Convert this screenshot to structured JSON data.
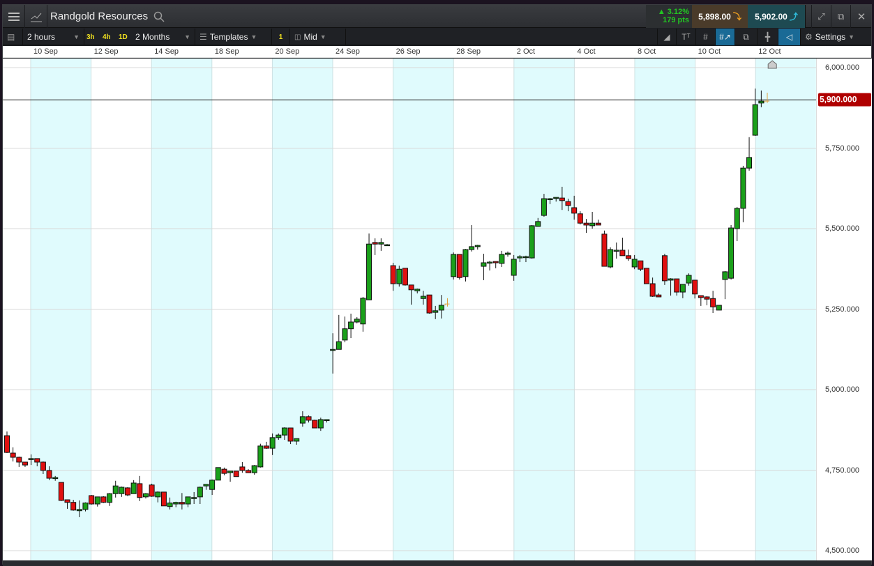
{
  "header": {
    "instrument": "Randgold Resources",
    "change_pct": "▲ 3.12%",
    "change_pts": "179 pts",
    "sell_price": "5,898.00",
    "buy_price": "5,902.00"
  },
  "toolbar": {
    "interval": "2 hours",
    "quick": [
      "3h",
      "4h",
      "1D"
    ],
    "range": "2 Months",
    "templates": "Templates",
    "count": "1",
    "price_type": "Mid",
    "settings": "Settings"
  },
  "x_axis": {
    "labels": [
      "10 Sep",
      "12 Sep",
      "14 Sep",
      "18 Sep",
      "20 Sep",
      "24 Sep",
      "26 Sep",
      "28 Sep",
      "2 Oct",
      "4 Oct",
      "8 Oct",
      "10 Oct",
      "12 Oct"
    ]
  },
  "chart_data": {
    "type": "candlestick",
    "title": "Randgold Resources",
    "ylim": [
      4500,
      6000
    ],
    "yticks": [
      {
        "v": 6000,
        "label": "6,000.000"
      },
      {
        "v": 5750,
        "label": "5,750.000"
      },
      {
        "v": 5500,
        "label": "5,500.000"
      },
      {
        "v": 5250,
        "label": "5,250.000"
      },
      {
        "v": 5000,
        "label": "5,000.000"
      },
      {
        "v": 4750,
        "label": "4,750.000"
      },
      {
        "v": 4500,
        "label": "4,500.000"
      }
    ],
    "current_price": 5900,
    "current_label": "5,900.000",
    "colors": {
      "up": "#1aa01a",
      "down": "#e01010",
      "neutral": "#e0a040"
    },
    "neutral_indices": [
      73,
      126
    ],
    "ohlc": [
      [
        4857,
        4870,
        4803,
        4805
      ],
      [
        4803,
        4821,
        4777,
        4790
      ],
      [
        4790,
        4792,
        4760,
        4775
      ],
      [
        4775,
        4775,
        4760,
        4766
      ],
      [
        4786,
        4799,
        4766,
        4786
      ],
      [
        4786,
        4786,
        4762,
        4775
      ],
      [
        4775,
        4777,
        4738,
        4749
      ],
      [
        4749,
        4762,
        4719,
        4725
      ],
      [
        4727,
        4732,
        4717,
        4727
      ],
      [
        4712,
        4712,
        4654,
        4656
      ],
      [
        4658,
        4658,
        4630,
        4650
      ],
      [
        4650,
        4658,
        4624,
        4626
      ],
      [
        4624,
        4656,
        4604,
        4628
      ],
      [
        4628,
        4650,
        4622,
        4648
      ],
      [
        4671,
        4673,
        4643,
        4645
      ],
      [
        4645,
        4667,
        4637,
        4667
      ],
      [
        4667,
        4669,
        4648,
        4650
      ],
      [
        4650,
        4679,
        4639,
        4677
      ],
      [
        4677,
        4717,
        4665,
        4701
      ],
      [
        4677,
        4699,
        4667,
        4697
      ],
      [
        4695,
        4697,
        4669,
        4673
      ],
      [
        4677,
        4719,
        4677,
        4710
      ],
      [
        4708,
        4732,
        4654,
        4665
      ],
      [
        4667,
        4679,
        4662,
        4677
      ],
      [
        4704,
        4708,
        4667,
        4669
      ],
      [
        4667,
        4684,
        4650,
        4682
      ],
      [
        4682,
        4682,
        4639,
        4639
      ],
      [
        4637,
        4665,
        4628,
        4648
      ],
      [
        4645,
        4652,
        4635,
        4650
      ],
      [
        4650,
        4679,
        4628,
        4645
      ],
      [
        4645,
        4667,
        4635,
        4667
      ],
      [
        4665,
        4682,
        4645,
        4665
      ],
      [
        4667,
        4699,
        4645,
        4697
      ],
      [
        4701,
        4706,
        4689,
        4706
      ],
      [
        4690,
        4721,
        4673,
        4719
      ],
      [
        4719,
        4758,
        4719,
        4758
      ],
      [
        4753,
        4758,
        4734,
        4740
      ],
      [
        4742,
        4747,
        4714,
        4747
      ],
      [
        4747,
        4747,
        4730,
        4730
      ],
      [
        4760,
        4775,
        4742,
        4749
      ],
      [
        4749,
        4753,
        4742,
        4742
      ],
      [
        4742,
        4766,
        4736,
        4764
      ],
      [
        4760,
        4832,
        4758,
        4825
      ],
      [
        4825,
        4838,
        4816,
        4818
      ],
      [
        4818,
        4864,
        4797,
        4851
      ],
      [
        4851,
        4864,
        4844,
        4859
      ],
      [
        4859,
        4883,
        4844,
        4881
      ],
      [
        4881,
        4881,
        4831,
        4840
      ],
      [
        4840,
        4848,
        4829,
        4848
      ],
      [
        4896,
        4933,
        4885,
        4916
      ],
      [
        4916,
        4920,
        4898,
        4905
      ],
      [
        4905,
        4907,
        4881,
        4881
      ],
      [
        4881,
        4913,
        4872,
        4907
      ],
      [
        4907,
        4907,
        4898,
        4907
      ],
      [
        5125,
        5175,
        5050,
        5125
      ],
      [
        5125,
        5232,
        5125,
        5149
      ],
      [
        5154,
        5227,
        5147,
        5189
      ],
      [
        5189,
        5236,
        5160,
        5210
      ],
      [
        5210,
        5225,
        5206,
        5219
      ],
      [
        5204,
        5288,
        5180,
        5284
      ],
      [
        5279,
        5485,
        5279,
        5452
      ],
      [
        5457,
        5470,
        5418,
        5452
      ],
      [
        5452,
        5470,
        5431,
        5457
      ],
      [
        5450,
        5452,
        5446,
        5450
      ],
      [
        5385,
        5394,
        5307,
        5329
      ],
      [
        5329,
        5385,
        5320,
        5374
      ],
      [
        5377,
        5377,
        5323,
        5325
      ],
      [
        5325,
        5325,
        5264,
        5310
      ],
      [
        5307,
        5314,
        5299,
        5312
      ],
      [
        5283,
        5307,
        5264,
        5290
      ],
      [
        5294,
        5294,
        5236,
        5238
      ],
      [
        5240,
        5260,
        5219,
        5245
      ],
      [
        5247,
        5294,
        5221,
        5262
      ],
      [
        5266,
        5284,
        5258,
        5266
      ],
      [
        5351,
        5426,
        5342,
        5420
      ],
      [
        5420,
        5420,
        5342,
        5348
      ],
      [
        5351,
        5437,
        5336,
        5435
      ],
      [
        5435,
        5511,
        5429,
        5444
      ],
      [
        5444,
        5450,
        5435,
        5448
      ],
      [
        5383,
        5422,
        5340,
        5394
      ],
      [
        5396,
        5400,
        5370,
        5396
      ],
      [
        5398,
        5398,
        5377,
        5394
      ],
      [
        5392,
        5431,
        5381,
        5420
      ],
      [
        5420,
        5429,
        5413,
        5424
      ],
      [
        5355,
        5418,
        5338,
        5405
      ],
      [
        5409,
        5418,
        5396,
        5413
      ],
      [
        5413,
        5416,
        5396,
        5413
      ],
      [
        5409,
        5511,
        5407,
        5509
      ],
      [
        5507,
        5533,
        5507,
        5522
      ],
      [
        5541,
        5608,
        5537,
        5593
      ],
      [
        5593,
        5595,
        5576,
        5593
      ],
      [
        5595,
        5597,
        5584,
        5597
      ],
      [
        5595,
        5630,
        5558,
        5587
      ],
      [
        5584,
        5593,
        5554,
        5572
      ],
      [
        5565,
        5602,
        5528,
        5548
      ],
      [
        5546,
        5554,
        5513,
        5517
      ],
      [
        5517,
        5530,
        5487,
        5511
      ],
      [
        5509,
        5552,
        5500,
        5517
      ],
      [
        5517,
        5528,
        5511,
        5511
      ],
      [
        5483,
        5494,
        5383,
        5383
      ],
      [
        5381,
        5442,
        5377,
        5435
      ],
      [
        5433,
        5457,
        5407,
        5433
      ],
      [
        5433,
        5472,
        5416,
        5416
      ],
      [
        5416,
        5435,
        5400,
        5407
      ],
      [
        5381,
        5418,
        5374,
        5405
      ],
      [
        5400,
        5400,
        5368,
        5374
      ],
      [
        5377,
        5377,
        5329,
        5329
      ],
      [
        5329,
        5348,
        5288,
        5290
      ],
      [
        5294,
        5299,
        5288,
        5288
      ],
      [
        5416,
        5422,
        5325,
        5338
      ],
      [
        5340,
        5346,
        5292,
        5344
      ],
      [
        5344,
        5344,
        5292,
        5303
      ],
      [
        5303,
        5327,
        5284,
        5327
      ],
      [
        5331,
        5361,
        5323,
        5355
      ],
      [
        5340,
        5340,
        5283,
        5297
      ],
      [
        5292,
        5292,
        5260,
        5286
      ],
      [
        5288,
        5290,
        5262,
        5281
      ],
      [
        5283,
        5307,
        5238,
        5257
      ],
      [
        5247,
        5262,
        5247,
        5262
      ],
      [
        5342,
        5368,
        5281,
        5366
      ],
      [
        5346,
        5511,
        5342,
        5502
      ],
      [
        5500,
        5567,
        5461,
        5563
      ],
      [
        5563,
        5695,
        5520,
        5688
      ],
      [
        5688,
        5784,
        5680,
        5721
      ],
      [
        5790,
        5935,
        5788,
        5885
      ],
      [
        5890,
        5929,
        5877,
        5896
      ],
      [
        5896,
        5922,
        5890,
        5896
      ]
    ]
  }
}
